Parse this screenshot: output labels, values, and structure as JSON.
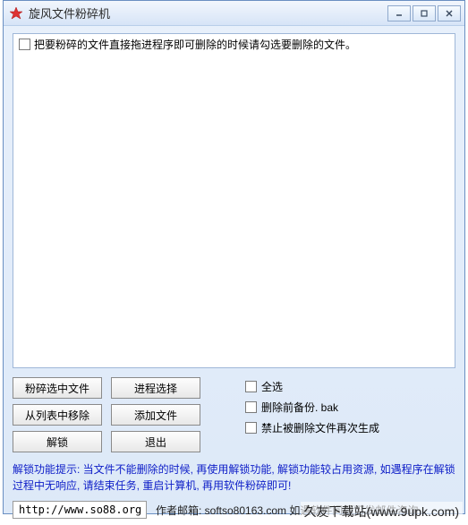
{
  "titlebar": {
    "title": "旋风文件粉碎机"
  },
  "list": {
    "header": "把要粉碎的文件直接拖进程序即可删除的时候请勾选要删除的文件。"
  },
  "buttons": {
    "shred_selected": "粉碎选中文件",
    "process_select": "进程选择",
    "remove_from_list": "从列表中移除",
    "add_file": "添加文件",
    "unlock": "解锁",
    "exit": "退出"
  },
  "checks": {
    "select_all": "全选",
    "backup_before_delete": "删除前备份. bak",
    "prevent_regen": "禁止被删除文件再次生成"
  },
  "hint": "解锁功能提示: 当文件不能删除的时候, 再使用解锁功能, 解锁功能较占用资源, 如遇程序在解锁过程中无响应, 请结束任务, 重启计算机, 再用软件粉碎即可!",
  "footer": {
    "url": "http://www.so88.org",
    "author_email": "作者邮箱: softso80163.com 如遇软件问题可发邮件咨询"
  },
  "watermark": "久友下载站(www.9upk.com)"
}
